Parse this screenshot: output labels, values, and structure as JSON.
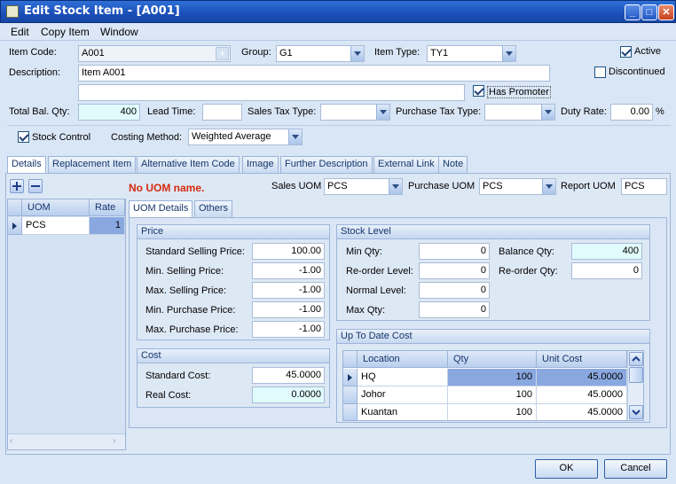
{
  "window": {
    "title": "Edit Stock Item - [A001]"
  },
  "menu": [
    "Edit",
    "Copy Item",
    "Window"
  ],
  "header": {
    "item_code_label": "Item Code:",
    "item_code": "A001",
    "group_label": "Group:",
    "group": "G1",
    "item_type_label": "Item Type:",
    "item_type": "TY1",
    "active_label": "Active",
    "active": true,
    "description_label": "Description:",
    "description": "Item A001",
    "description2": "",
    "discontinued_label": "Discontinued",
    "discontinued": false,
    "has_promoter_label": "Has Promoter",
    "has_promoter": true,
    "total_bal_label": "Total Bal. Qty:",
    "total_bal": "400",
    "lead_time_label": "Lead Time:",
    "lead_time": "",
    "sales_tax_label": "Sales Tax Type:",
    "sales_tax": "",
    "purchase_tax_label": "Purchase Tax Type:",
    "purchase_tax": "",
    "duty_rate_label": "Duty Rate:",
    "duty_rate": "0.00",
    "duty_unit": "%",
    "stock_control_label": "Stock Control",
    "stock_control": true,
    "costing_label": "Costing Method:",
    "costing": "Weighted Average"
  },
  "tabs": [
    "Details",
    "Replacement Item",
    "Alternative Item Code",
    "Image",
    "Further Description",
    "External Link",
    "Note"
  ],
  "uom_panel": {
    "warning": "No UOM name.",
    "columns": [
      "UOM",
      "Rate"
    ],
    "rows": [
      {
        "uom": "PCS",
        "rate": "1"
      }
    ],
    "sales_uom_label": "Sales UOM",
    "sales_uom": "PCS",
    "purchase_uom_label": "Purchase UOM",
    "purchase_uom": "PCS",
    "report_uom_label": "Report UOM",
    "report_uom": "PCS"
  },
  "subtabs": [
    "UOM Details",
    "Others"
  ],
  "price": {
    "title": "Price",
    "std_sell_label": "Standard Selling Price:",
    "std_sell": "100.00",
    "min_sell_label": "Min. Selling Price:",
    "min_sell": "-1.00",
    "max_sell_label": "Max. Selling Price:",
    "max_sell": "-1.00",
    "min_purch_label": "Min. Purchase Price:",
    "min_purch": "-1.00",
    "max_purch_label": "Max. Purchase Price:",
    "max_purch": "-1.00"
  },
  "cost": {
    "title": "Cost",
    "std_cost_label": "Standard Cost:",
    "std_cost": "45.0000",
    "real_cost_label": "Real Cost:",
    "real_cost": "0.0000"
  },
  "stock_level": {
    "title": "Stock Level",
    "min_qty_label": "Min Qty:",
    "min_qty": "0",
    "reorder_level_label": "Re-order Level:",
    "reorder_level": "0",
    "normal_level_label": "Normal Level:",
    "normal_level": "0",
    "max_qty_label": "Max Qty:",
    "max_qty": "0",
    "balance_qty_label": "Balance Qty:",
    "balance_qty": "400",
    "reorder_qty_label": "Re-order Qty:",
    "reorder_qty": "0"
  },
  "up_to_date": {
    "title": "Up To Date Cost",
    "columns": [
      "Location",
      "Qty",
      "Unit Cost"
    ],
    "rows": [
      {
        "location": "HQ",
        "qty": "100",
        "unit_cost": "45.0000"
      },
      {
        "location": "Johor",
        "qty": "100",
        "unit_cost": "45.0000"
      },
      {
        "location": "Kuantan",
        "qty": "100",
        "unit_cost": "45.0000"
      }
    ]
  },
  "footer": {
    "ok": "OK",
    "cancel": "Cancel"
  }
}
